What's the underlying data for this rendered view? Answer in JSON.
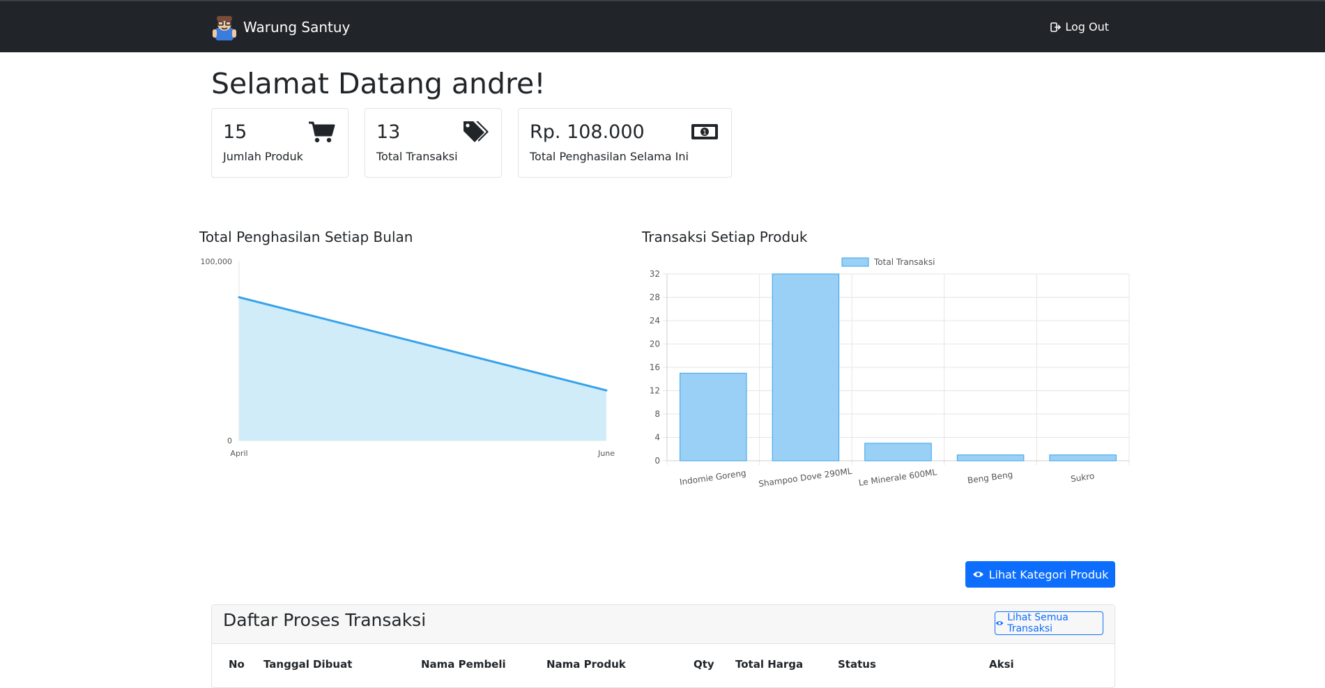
{
  "navbar": {
    "brand": "Warung Santuy",
    "logout_label": "Log Out"
  },
  "welcome": "Selamat Datang andre!",
  "stats": [
    {
      "value": "15",
      "label": "Jumlah Produk",
      "icon": "cart-icon"
    },
    {
      "value": "13",
      "label": "Total Transaksi",
      "icon": "tags-icon"
    },
    {
      "value": "Rp. 108.000",
      "label": "Total Penghasilan Selama Ini",
      "icon": "money-icon"
    }
  ],
  "charts": {
    "income_title": "Total Penghasilan Setiap Bulan",
    "transactions_title": "Transaksi Setiap Produk"
  },
  "chart_data": [
    {
      "type": "area",
      "x": [
        "April",
        "June"
      ],
      "series": [
        {
          "values": [
            80000,
            28000
          ]
        }
      ],
      "ylim": [
        0,
        100000
      ],
      "yticks": [
        "100,000",
        "0"
      ],
      "color": "#36a2eb",
      "fill": "#d1ecf9",
      "grid": false,
      "legend": "none"
    },
    {
      "type": "bar",
      "categories": [
        "Indomie Goreng",
        "Shampoo Dove 290ML",
        "Le Minerale 600ML",
        "Beng Beng",
        "Sukro"
      ],
      "series": [
        {
          "name": "Total Transaksi",
          "values": [
            15,
            32,
            3,
            1,
            1
          ]
        }
      ],
      "ylim": [
        0,
        32
      ],
      "yticks": [
        "0",
        "4",
        "8",
        "12",
        "16",
        "20",
        "24",
        "28",
        "32"
      ],
      "color": "#9ad0f5",
      "border": "#36a2eb",
      "grid": true,
      "legend": "top"
    }
  ],
  "actions": {
    "kategori_label": "Lihat Kategori Produk"
  },
  "transaksi_panel": {
    "title": "Daftar Proses Transaksi",
    "semua_label": "Lihat Semua Transaksi",
    "columns": [
      "No",
      "Tanggal Dibuat",
      "Nama Pembeli",
      "Nama Produk",
      "Qty",
      "Total Harga",
      "Status",
      "Aksi"
    ]
  }
}
